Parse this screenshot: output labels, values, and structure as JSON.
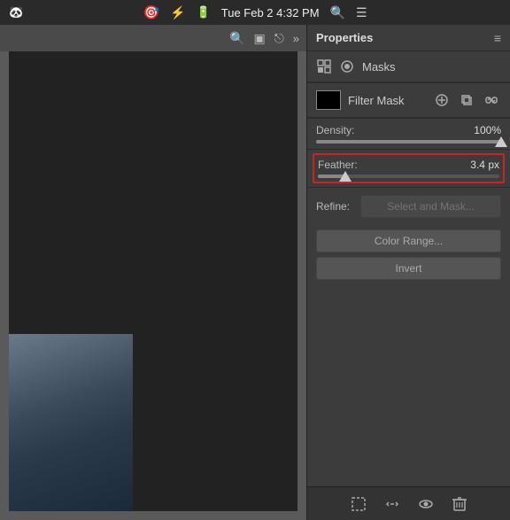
{
  "menubar": {
    "time": "Tue Feb 2  4:32 PM",
    "icons": [
      "🎯",
      "⚡",
      "🔋"
    ]
  },
  "toolbar": {
    "search_icon": "🔍",
    "grid_icon": "⊞",
    "share_icon": "⎋"
  },
  "panel": {
    "title": "Properties",
    "menu_icon": "≡",
    "masks_label": "Masks",
    "filter_mask_label": "Filter Mask",
    "density_label": "Density:",
    "density_value": "100%",
    "feather_label": "Feather:",
    "feather_value": "3.4 px",
    "refine_label": "Refine:",
    "select_mask_btn": "Select and Mask...",
    "color_range_btn": "Color Range...",
    "invert_btn": "Invert"
  },
  "bottom_toolbar": {
    "dashed_rect_icon": "⬚",
    "link_icon": "❖",
    "eye_icon": "◉",
    "trash_icon": "🗑"
  }
}
